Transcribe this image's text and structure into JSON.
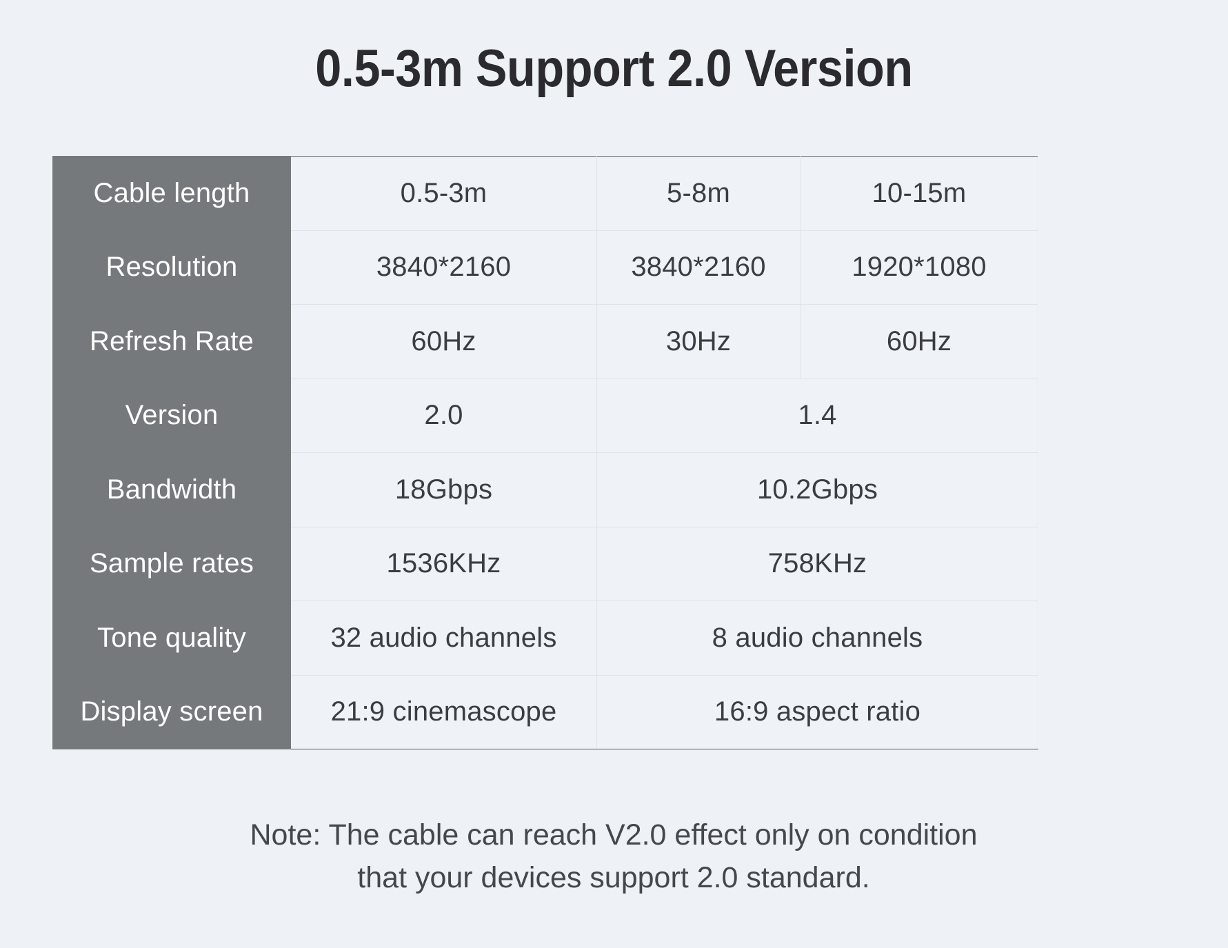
{
  "colors": {
    "page_background": "#eef1f6",
    "cell_background": "#eff2f7",
    "row_header_background": "#76797c",
    "row_header_text": "#ffffff",
    "cell_text": "#3a3d42",
    "title_text": "#2b2b2f",
    "border": "#dfe4ec"
  },
  "header": {
    "title": "0.5-3m Support 2.0 Version"
  },
  "table": {
    "row_labels": [
      "Cable length",
      "Resolution",
      "Refresh Rate",
      "Version",
      "Bandwidth",
      "Sample rates",
      "Tone quality",
      "Display screen"
    ],
    "rows": [
      {
        "label": "Cable length",
        "merged": false,
        "cells": [
          "0.5-3m",
          "5-8m",
          "10-15m"
        ]
      },
      {
        "label": "Resolution",
        "merged": false,
        "cells": [
          "3840*2160",
          "3840*2160",
          "1920*1080"
        ]
      },
      {
        "label": "Refresh Rate",
        "merged": false,
        "cells": [
          "60Hz",
          "30Hz",
          "60Hz"
        ]
      },
      {
        "label": "Version",
        "merged": true,
        "cells": [
          "2.0",
          "1.4"
        ]
      },
      {
        "label": "Bandwidth",
        "merged": true,
        "cells": [
          "18Gbps",
          "10.2Gbps"
        ]
      },
      {
        "label": "Sample rates",
        "merged": true,
        "cells": [
          "1536KHz",
          "758KHz"
        ]
      },
      {
        "label": "Tone quality",
        "merged": true,
        "cells": [
          "32 audio channels",
          "8 audio channels"
        ]
      },
      {
        "label": "Display screen",
        "merged": true,
        "cells": [
          "21:9 cinemascope",
          "16:9 aspect ratio"
        ]
      }
    ]
  },
  "note": {
    "line1": "Note: The cable can reach V2.0 effect only on condition",
    "line2": "that your devices support 2.0 standard."
  }
}
